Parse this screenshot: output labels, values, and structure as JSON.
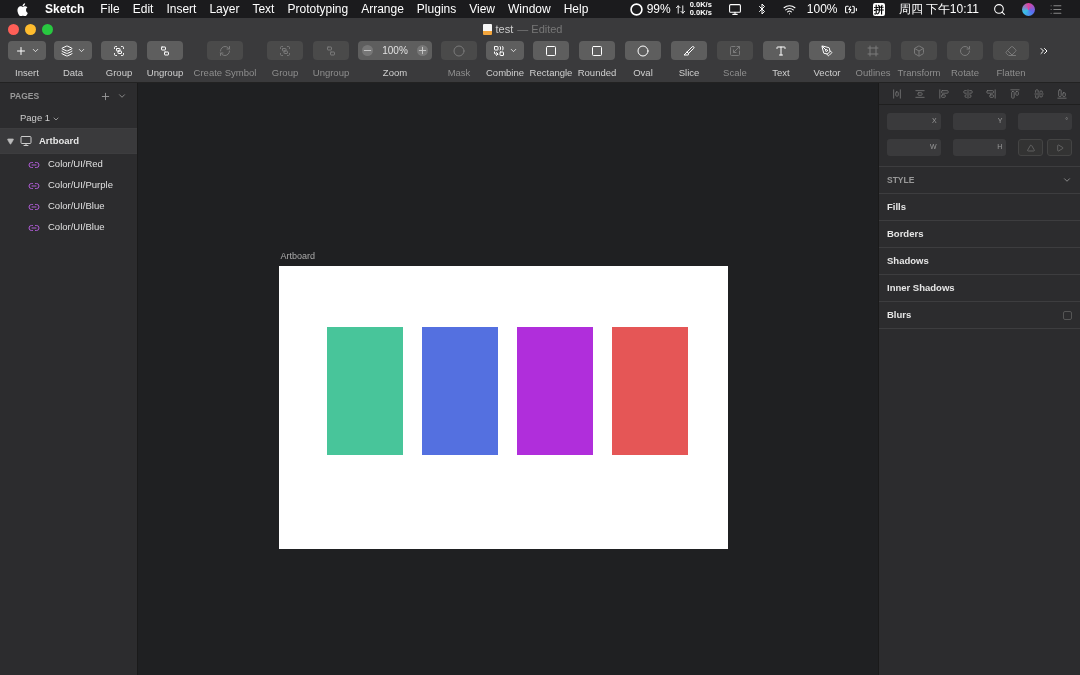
{
  "menubar": {
    "app": "Sketch",
    "menus": [
      "File",
      "Edit",
      "Insert",
      "Layer",
      "Text",
      "Prototyping",
      "Arrange",
      "Plugins",
      "View",
      "Window",
      "Help"
    ],
    "status": {
      "cpu": "99%",
      "net_up": "0.0K/s",
      "net_down": "0.0K/s",
      "battery": "100%",
      "input_method": "拼",
      "clock": "周四 下午10:11"
    }
  },
  "window": {
    "title": "test",
    "subtitle": "— Edited"
  },
  "toolbar": [
    {
      "label": "Insert",
      "kind": "dropdown",
      "disabled": false
    },
    {
      "label": "Data",
      "kind": "dropdown",
      "disabled": false
    },
    {
      "label": "Group",
      "kind": "button",
      "disabled": false
    },
    {
      "label": "Ungroup",
      "kind": "button",
      "disabled": false
    },
    {
      "label": "Create Symbol",
      "kind": "wide",
      "disabled": true
    },
    {
      "label": "Group",
      "kind": "button",
      "disabled": true
    },
    {
      "label": "Ungroup",
      "kind": "button",
      "disabled": true
    },
    {
      "label": "Zoom",
      "kind": "zoom",
      "value": "100%",
      "disabled": false
    },
    {
      "label": "Mask",
      "kind": "button",
      "disabled": true
    },
    {
      "label": "Combine",
      "kind": "dropdown",
      "disabled": false
    },
    {
      "label": "Rectangle",
      "kind": "button",
      "disabled": false
    },
    {
      "label": "Rounded",
      "kind": "button",
      "disabled": false
    },
    {
      "label": "Oval",
      "kind": "button",
      "disabled": false
    },
    {
      "label": "Slice",
      "kind": "button",
      "disabled": false
    },
    {
      "label": "Scale",
      "kind": "button",
      "disabled": true
    },
    {
      "label": "Text",
      "kind": "button",
      "disabled": false
    },
    {
      "label": "Vector",
      "kind": "button",
      "disabled": false
    },
    {
      "label": "Outlines",
      "kind": "button",
      "disabled": true
    },
    {
      "label": "Transform",
      "kind": "button",
      "disabled": true
    },
    {
      "label": "Rotate",
      "kind": "button",
      "disabled": true
    },
    {
      "label": "Flatten",
      "kind": "button",
      "disabled": true
    }
  ],
  "sidebar": {
    "heading": "PAGES",
    "page": "Page 1",
    "layers": [
      {
        "name": "Artboard",
        "expanded": true,
        "selected": true,
        "children": [
          {
            "name": "Color/UI/Red"
          },
          {
            "name": "Color/UI/Purple"
          },
          {
            "name": "Color/UI/Blue"
          },
          {
            "name": "Color/UI/Blue"
          }
        ]
      }
    ]
  },
  "canvas": {
    "artboard_label": "Artboard",
    "shapes": [
      {
        "color": "#48c59a"
      },
      {
        "color": "#5470e0"
      },
      {
        "color": "#b02edb"
      },
      {
        "color": "#e55656"
      }
    ]
  },
  "inspector": {
    "fields": [
      {
        "label": "X"
      },
      {
        "label": "Y"
      },
      {
        "label": "°"
      },
      {
        "label": "W"
      },
      {
        "label": "H"
      }
    ],
    "style_heading": "STYLE",
    "sections": [
      {
        "label": "Fills",
        "kind": "plain"
      },
      {
        "label": "Borders",
        "kind": "plain"
      },
      {
        "label": "Shadows",
        "kind": "plain"
      },
      {
        "label": "Inner Shadows",
        "kind": "plain"
      },
      {
        "label": "Blurs",
        "kind": "toggle",
        "checked": false
      }
    ]
  }
}
